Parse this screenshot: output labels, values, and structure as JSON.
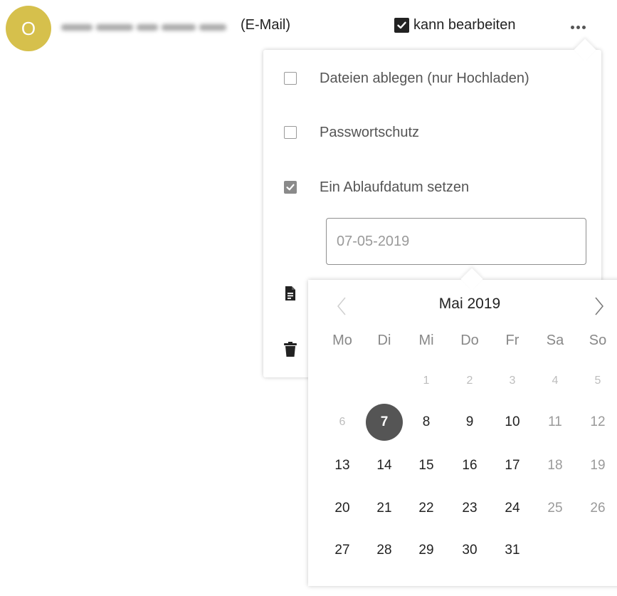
{
  "colors": {
    "avatar_bg": "#d6c04c",
    "selected_day_bg": "#555555"
  },
  "share": {
    "avatar_initial": "O",
    "email_redacted": "",
    "type_label": "(E-Mail)",
    "can_edit_label": "kann bearbeiten",
    "can_edit_checked": true,
    "more_icon": "ellipsis-icon"
  },
  "menu": {
    "items": [
      {
        "label": "Dateien ablegen (nur Hochladen)",
        "checked": false
      },
      {
        "label": "Passwortschutz",
        "checked": false
      },
      {
        "label": "Ein Ablaufdatum setzen",
        "checked": true
      }
    ],
    "expiry_date_value": "07-05-2019",
    "note_icon": "note-icon",
    "delete_icon": "trash-icon"
  },
  "datepicker": {
    "month_label": "Mai 2019",
    "prev_icon": "chevron-left-icon",
    "next_icon": "chevron-right-icon",
    "weekdays": [
      "Mo",
      "Di",
      "Mi",
      "Do",
      "Fr",
      "Sa",
      "So"
    ],
    "weeks": [
      [
        {
          "d": "",
          "type": "empty"
        },
        {
          "d": "",
          "type": "empty"
        },
        {
          "d": "1",
          "type": "out"
        },
        {
          "d": "2",
          "type": "out"
        },
        {
          "d": "3",
          "type": "out"
        },
        {
          "d": "4",
          "type": "out"
        },
        {
          "d": "5",
          "type": "out"
        }
      ],
      [
        {
          "d": "6",
          "type": "out"
        },
        {
          "d": "7",
          "type": "selected"
        },
        {
          "d": "8",
          "type": "normal"
        },
        {
          "d": "9",
          "type": "normal"
        },
        {
          "d": "10",
          "type": "normal"
        },
        {
          "d": "11",
          "type": "weekend"
        },
        {
          "d": "12",
          "type": "weekend"
        }
      ],
      [
        {
          "d": "13",
          "type": "normal"
        },
        {
          "d": "14",
          "type": "normal"
        },
        {
          "d": "15",
          "type": "normal"
        },
        {
          "d": "16",
          "type": "normal"
        },
        {
          "d": "17",
          "type": "normal"
        },
        {
          "d": "18",
          "type": "weekend"
        },
        {
          "d": "19",
          "type": "weekend"
        }
      ],
      [
        {
          "d": "20",
          "type": "normal"
        },
        {
          "d": "21",
          "type": "normal"
        },
        {
          "d": "22",
          "type": "normal"
        },
        {
          "d": "23",
          "type": "normal"
        },
        {
          "d": "24",
          "type": "normal"
        },
        {
          "d": "25",
          "type": "weekend"
        },
        {
          "d": "26",
          "type": "weekend"
        }
      ],
      [
        {
          "d": "27",
          "type": "normal"
        },
        {
          "d": "28",
          "type": "normal"
        },
        {
          "d": "29",
          "type": "normal"
        },
        {
          "d": "30",
          "type": "normal"
        },
        {
          "d": "31",
          "type": "normal"
        },
        {
          "d": "",
          "type": "empty"
        },
        {
          "d": "",
          "type": "empty"
        }
      ]
    ]
  }
}
